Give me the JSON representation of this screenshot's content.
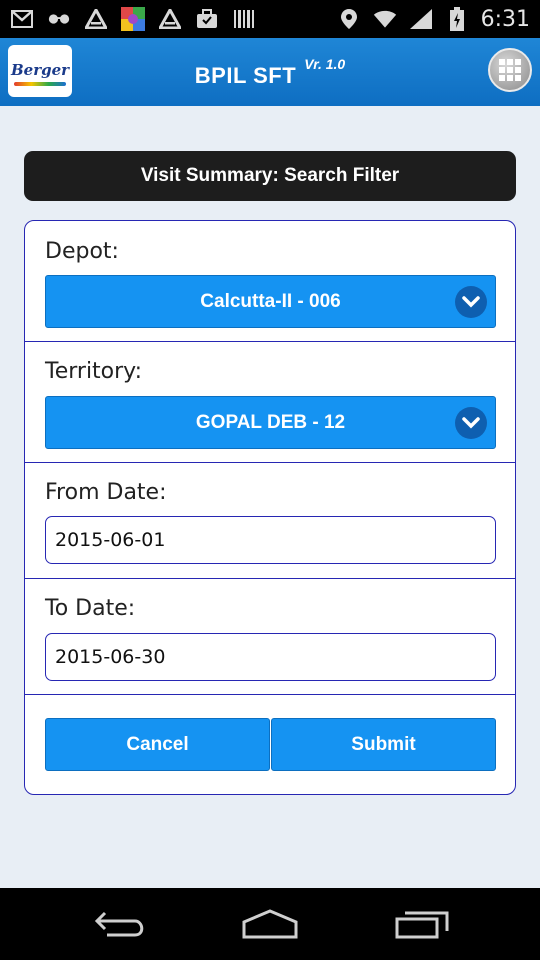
{
  "status_bar": {
    "time": "6:31",
    "icons_left": [
      "gmail-icon",
      "spy-icon",
      "app-a-icon",
      "photo-app-icon",
      "app-a-icon",
      "briefcase-icon",
      "barcode-icon"
    ],
    "icons_right": [
      "location-icon",
      "wifi-icon",
      "signal-icon",
      "battery-icon"
    ]
  },
  "header": {
    "logo_text": "Berger",
    "title": "BPIL SFT",
    "version": "Vr. 1.0",
    "menu_icon": "grid-menu-icon"
  },
  "filter": {
    "title": "Visit Summary: Search Filter",
    "depot": {
      "label": "Depot:",
      "value": "Calcutta-II - 006"
    },
    "territory": {
      "label": "Territory:",
      "value": "GOPAL DEB - 12"
    },
    "from_date": {
      "label": "From Date:",
      "value": "2015-06-01"
    },
    "to_date": {
      "label": "To Date:",
      "value": "2015-06-30"
    },
    "cancel_label": "Cancel",
    "submit_label": "Submit"
  },
  "nav": {
    "icons": [
      "back-icon",
      "home-icon",
      "recent-apps-icon"
    ]
  },
  "colors": {
    "header": "#1f86d6",
    "accent": "#1593f2",
    "border": "#2727b3",
    "background": "#e8eef5"
  }
}
